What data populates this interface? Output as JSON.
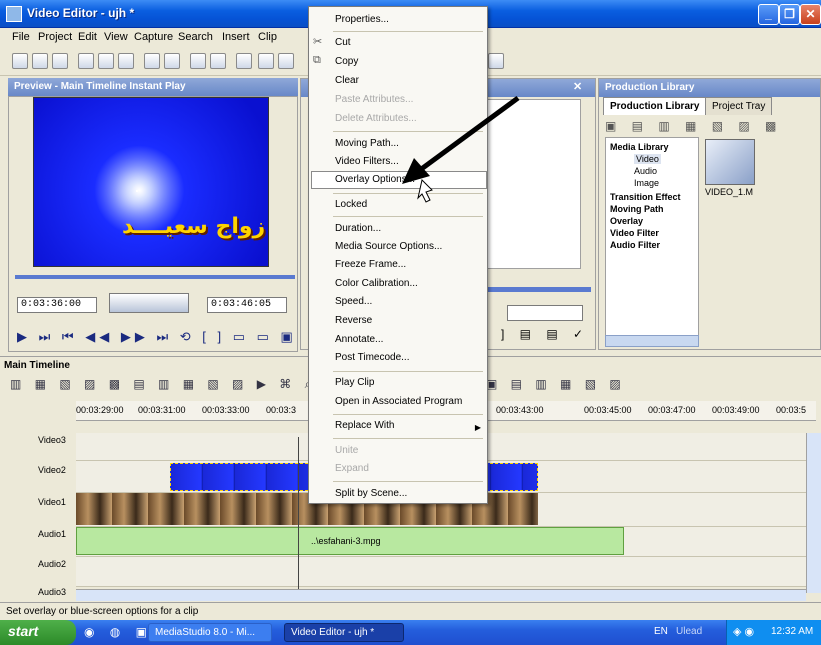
{
  "window": {
    "title": "Video Editor - ujh *"
  },
  "menubar": [
    "File",
    "Project",
    "Edit",
    "View",
    "Capture",
    "Search",
    "Insert",
    "Clip"
  ],
  "preview": {
    "panel_title": "Preview - Main Timeline Instant Play",
    "overlay_text": "زواج سعيــــد",
    "timecode_start": "0:03:36:00",
    "timecode_end": "0:03:46:05"
  },
  "library": {
    "panel_title": "Production Library",
    "tabs": [
      "Production Library",
      "Project Tray"
    ],
    "tree": [
      "Media Library",
      "Video",
      "Audio",
      "Image",
      "Transition Effect",
      "Moving Path",
      "Overlay",
      "Video Filter",
      "Audio Filter"
    ],
    "thumb_label": "VIDEO_1.M"
  },
  "timeline": {
    "tab": "Main Timeline",
    "ruler": [
      "00:03:29:00",
      "00:03:31:00",
      "00:03:33:00",
      "00:03:3",
      "00:03:43:00",
      "00:03:45:00",
      "00:03:47:00",
      "00:03:49:00",
      "00:03:5"
    ],
    "tracks": [
      "Video3",
      "Video2",
      "Video1",
      "Audio1",
      "Audio2",
      "Audio3"
    ],
    "audio_clip": "..\\esfahani-3.mpg"
  },
  "context_menu": {
    "items": [
      {
        "label": "Properties...",
        "disabled": false
      },
      {
        "label": "Cut",
        "disabled": false,
        "icon": "scissors-icon"
      },
      {
        "label": "Copy",
        "disabled": false,
        "icon": "copy-icon"
      },
      {
        "label": "Clear",
        "disabled": false
      },
      {
        "label": "Paste Attributes...",
        "disabled": true
      },
      {
        "label": "Delete Attributes...",
        "disabled": true
      },
      {
        "label": "Moving Path...",
        "disabled": false
      },
      {
        "label": "Video Filters...",
        "disabled": false
      },
      {
        "label": "Overlay Options...",
        "disabled": false,
        "highlighted": true
      },
      {
        "label": "Locked",
        "disabled": false
      },
      {
        "label": "Duration...",
        "disabled": false
      },
      {
        "label": "Media Source Options...",
        "disabled": false
      },
      {
        "label": "Freeze Frame...",
        "disabled": false
      },
      {
        "label": "Color Calibration...",
        "disabled": false
      },
      {
        "label": "Speed...",
        "disabled": false
      },
      {
        "label": "Reverse",
        "disabled": false
      },
      {
        "label": "Annotate...",
        "disabled": false
      },
      {
        "label": "Post Timecode...",
        "disabled": false
      },
      {
        "label": "Play Clip",
        "disabled": false
      },
      {
        "label": "Open in Associated Program",
        "disabled": false
      },
      {
        "label": "Replace With",
        "disabled": false,
        "submenu": true
      },
      {
        "label": "Unite",
        "disabled": true
      },
      {
        "label": "Expand",
        "disabled": true
      },
      {
        "label": "Split by Scene...",
        "disabled": false
      }
    ]
  },
  "status_text": "Set overlay or blue-screen options for a clip",
  "taskbar": {
    "start": "start",
    "tasks": [
      "MediaStudio 8.0 - Mi...",
      "Video Editor - ujh *"
    ],
    "tray_lang": "EN",
    "tray_label": "Ulead",
    "clock": "12:32 AM"
  },
  "colors": {
    "title_bar": "#0a5ee0",
    "taskbar": "#245edc",
    "start_button": "#2c8a28",
    "menu_bg": "#f9f8f3"
  }
}
